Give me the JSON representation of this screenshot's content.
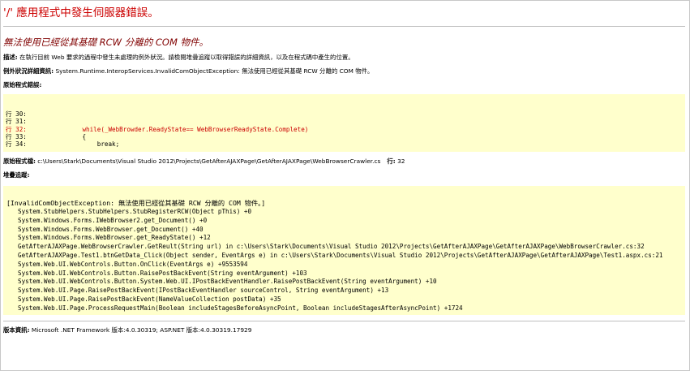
{
  "page": {
    "title": "'/' 應用程式中發生伺服器錯誤。",
    "error_message": "無法使用已經從其基礎 RCW 分離的 COM 物件。",
    "description_label": "描述:",
    "description_text": " 在執行目前 Web 要求的過程中發生未處理的例外狀況。請檢閱堆疊追蹤以取得錯誤的詳細資訊，以及在程式碼中產生的位置。",
    "exception_label": "例外狀況詳細資訊:",
    "exception_text": " System.Runtime.InteropServices.InvalidComObjectException: 無法使用已經從其基礎 RCW 分離的 COM 物件。",
    "source_error_label": "原始程式錯誤:",
    "source_file_label": "原始程式檔:",
    "source_file_path": " c:\\Users\\Stark\\Documents\\Visual Studio 2012\\Projects\\GetAfterAJAXPage\\GetAfterAJAXPage\\WebBrowserCrawler.cs",
    "line_label": "行:",
    "line_value": " 32",
    "stack_label": "堆疊追蹤:",
    "version_label": "版本資訊:",
    "version_text": " Microsoft .NET Framework 版本:4.0.30319; ASP.NET 版本:4.0.30319.17929"
  },
  "source_lines": [
    {
      "text": "行 30: ",
      "error": false
    },
    {
      "text": "行 31: ",
      "error": false
    },
    {
      "text": "行 32:               while(_WebBrowder.ReadyState== WebBrowserReadyState.Complete)",
      "error": true
    },
    {
      "text": "行 33:               {",
      "error": false
    },
    {
      "text": "行 34:                   break;",
      "error": false
    }
  ],
  "stack_header": "[InvalidComObjectException: 無法使用已經從其基礎 RCW 分離的 COM 物件。]",
  "stack_lines": [
    "System.StubHelpers.StubHelpers.StubRegisterRCW(Object pThis) +0",
    "System.Windows.Forms.IWebBrowser2.get_Document() +0",
    "System.Windows.Forms.WebBrowser.get_Document() +40",
    "System.Windows.Forms.WebBrowser.get_ReadyState() +12",
    "GetAfterAJAXPage.WebBrowserCrawler.GetReult(String url) in c:\\Users\\Stark\\Documents\\Visual Studio 2012\\Projects\\GetAfterAJAXPage\\GetAfterAJAXPage\\WebBrowserCrawler.cs:32",
    "GetAfterAJAXPage.Test1.btnGetData_Click(Object sender, EventArgs e) in c:\\Users\\Stark\\Documents\\Visual Studio 2012\\Projects\\GetAfterAJAXPage\\GetAfterAJAXPage\\Test1.aspx.cs:21",
    "System.Web.UI.WebControls.Button.OnClick(EventArgs e) +9553594",
    "System.Web.UI.WebControls.Button.RaisePostBackEvent(String eventArgument) +103",
    "System.Web.UI.WebControls.Button.System.Web.UI.IPostBackEventHandler.RaisePostBackEvent(String eventArgument) +10",
    "System.Web.UI.Page.RaisePostBackEvent(IPostBackEventHandler sourceControl, String eventArgument) +13",
    "System.Web.UI.Page.RaisePostBackEvent(NameValueCollection postData) +35",
    "System.Web.UI.Page.ProcessRequestMain(Boolean includeStagesBeforeAsyncPoint, Boolean includeStagesAfterAsyncPoint) +1724"
  ]
}
